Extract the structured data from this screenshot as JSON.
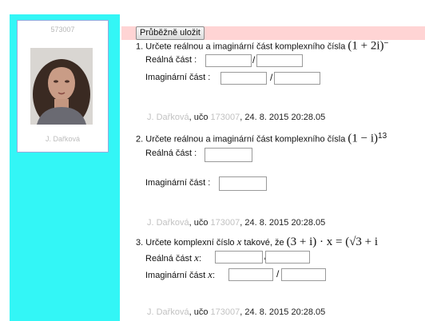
{
  "sidebar": {
    "student_id": "573007",
    "photo_name": "J. Dařková",
    "bg_color": "#33f6f6"
  },
  "toolbar": {
    "save_label": "Průběžně uložit"
  },
  "questions": [
    {
      "number": "1.",
      "prompt": "Určete reálnou a imaginární část komplexního čísla",
      "math": "(1 + 2i)",
      "math_sup": "−",
      "real_label": "Reálná část :",
      "imag_label": "Imaginární část :",
      "real_num": "",
      "real_den": "",
      "imag_num": "",
      "imag_den": "",
      "footer": {
        "author": "J. Dařková",
        "uco_label": "učo",
        "uco": "173007",
        "timestamp": "24. 8. 2015 20:28.05"
      }
    },
    {
      "number": "2.",
      "prompt": "Určete reálnou a imaginární část komplexního čísla",
      "math": "(1 − i)",
      "math_sup": "13",
      "real_label": "Reálná část :",
      "imag_label": "Imaginární část :",
      "real_value": "",
      "imag_value": "",
      "footer": {
        "author": "J. Dařková",
        "uco_label": "učo",
        "uco": "173007",
        "timestamp": "24. 8. 2015 20:28.05"
      }
    },
    {
      "number": "3.",
      "prompt_a": "Určete komplexní číslo",
      "var": "x",
      "prompt_b": "takové, že",
      "math": "(3 + i) · x = (√3 + i",
      "real_label": "Reálná část",
      "imag_label": "Imaginární část",
      "real_num": "",
      "real_den": "",
      "imag_num": "",
      "imag_den": "",
      "footer": {
        "author": "J. Dařková",
        "uco_label": "učo",
        "uco": "173007",
        "timestamp": "24. 8. 2015 20:28.05"
      }
    }
  ],
  "slash": "/",
  "colon": ":"
}
